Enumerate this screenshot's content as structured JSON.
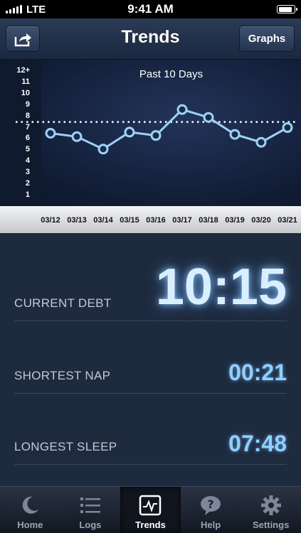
{
  "status_bar": {
    "carrier": "LTE",
    "time": "9:41 AM",
    "battery_level": 0.9
  },
  "nav": {
    "title": "Trends",
    "share_icon": "share-icon",
    "graphs_label": "Graphs"
  },
  "chart_data": {
    "type": "line",
    "title": "Past 10 Days",
    "x": [
      "03/12",
      "03/13",
      "03/14",
      "03/15",
      "03/16",
      "03/17",
      "03/18",
      "03/19",
      "03/20",
      "03/21"
    ],
    "y_ticks": [
      "1",
      "2",
      "3",
      "4",
      "5",
      "6",
      "7",
      "8",
      "9",
      "10",
      "11",
      "12+"
    ],
    "series": [
      {
        "values": [
          6.5,
          6.2,
          5.1,
          6.6,
          6.3,
          8.6,
          7.9,
          6.4,
          5.7,
          7.0
        ]
      }
    ],
    "reference_line": 7.5,
    "ylim": [
      0,
      12
    ],
    "grid": false,
    "colors": {
      "line": "#9cd2f6",
      "reference": "#ffffff"
    }
  },
  "stats": {
    "current_debt": {
      "label": "CURRENT DEBT",
      "value": "10:15"
    },
    "shortest_nap": {
      "label": "SHORTEST NAP",
      "value": "00:21"
    },
    "longest_sleep": {
      "label": "LONGEST SLEEP",
      "value": "07:48"
    }
  },
  "tabs": [
    {
      "label": "Home",
      "icon": "moon-icon",
      "active": false
    },
    {
      "label": "Logs",
      "icon": "list-icon",
      "active": false
    },
    {
      "label": "Trends",
      "icon": "trend-chart-icon",
      "active": true
    },
    {
      "label": "Help",
      "icon": "help-bubble-icon",
      "active": false
    },
    {
      "label": "Settings",
      "icon": "gear-icon",
      "active": false
    }
  ]
}
